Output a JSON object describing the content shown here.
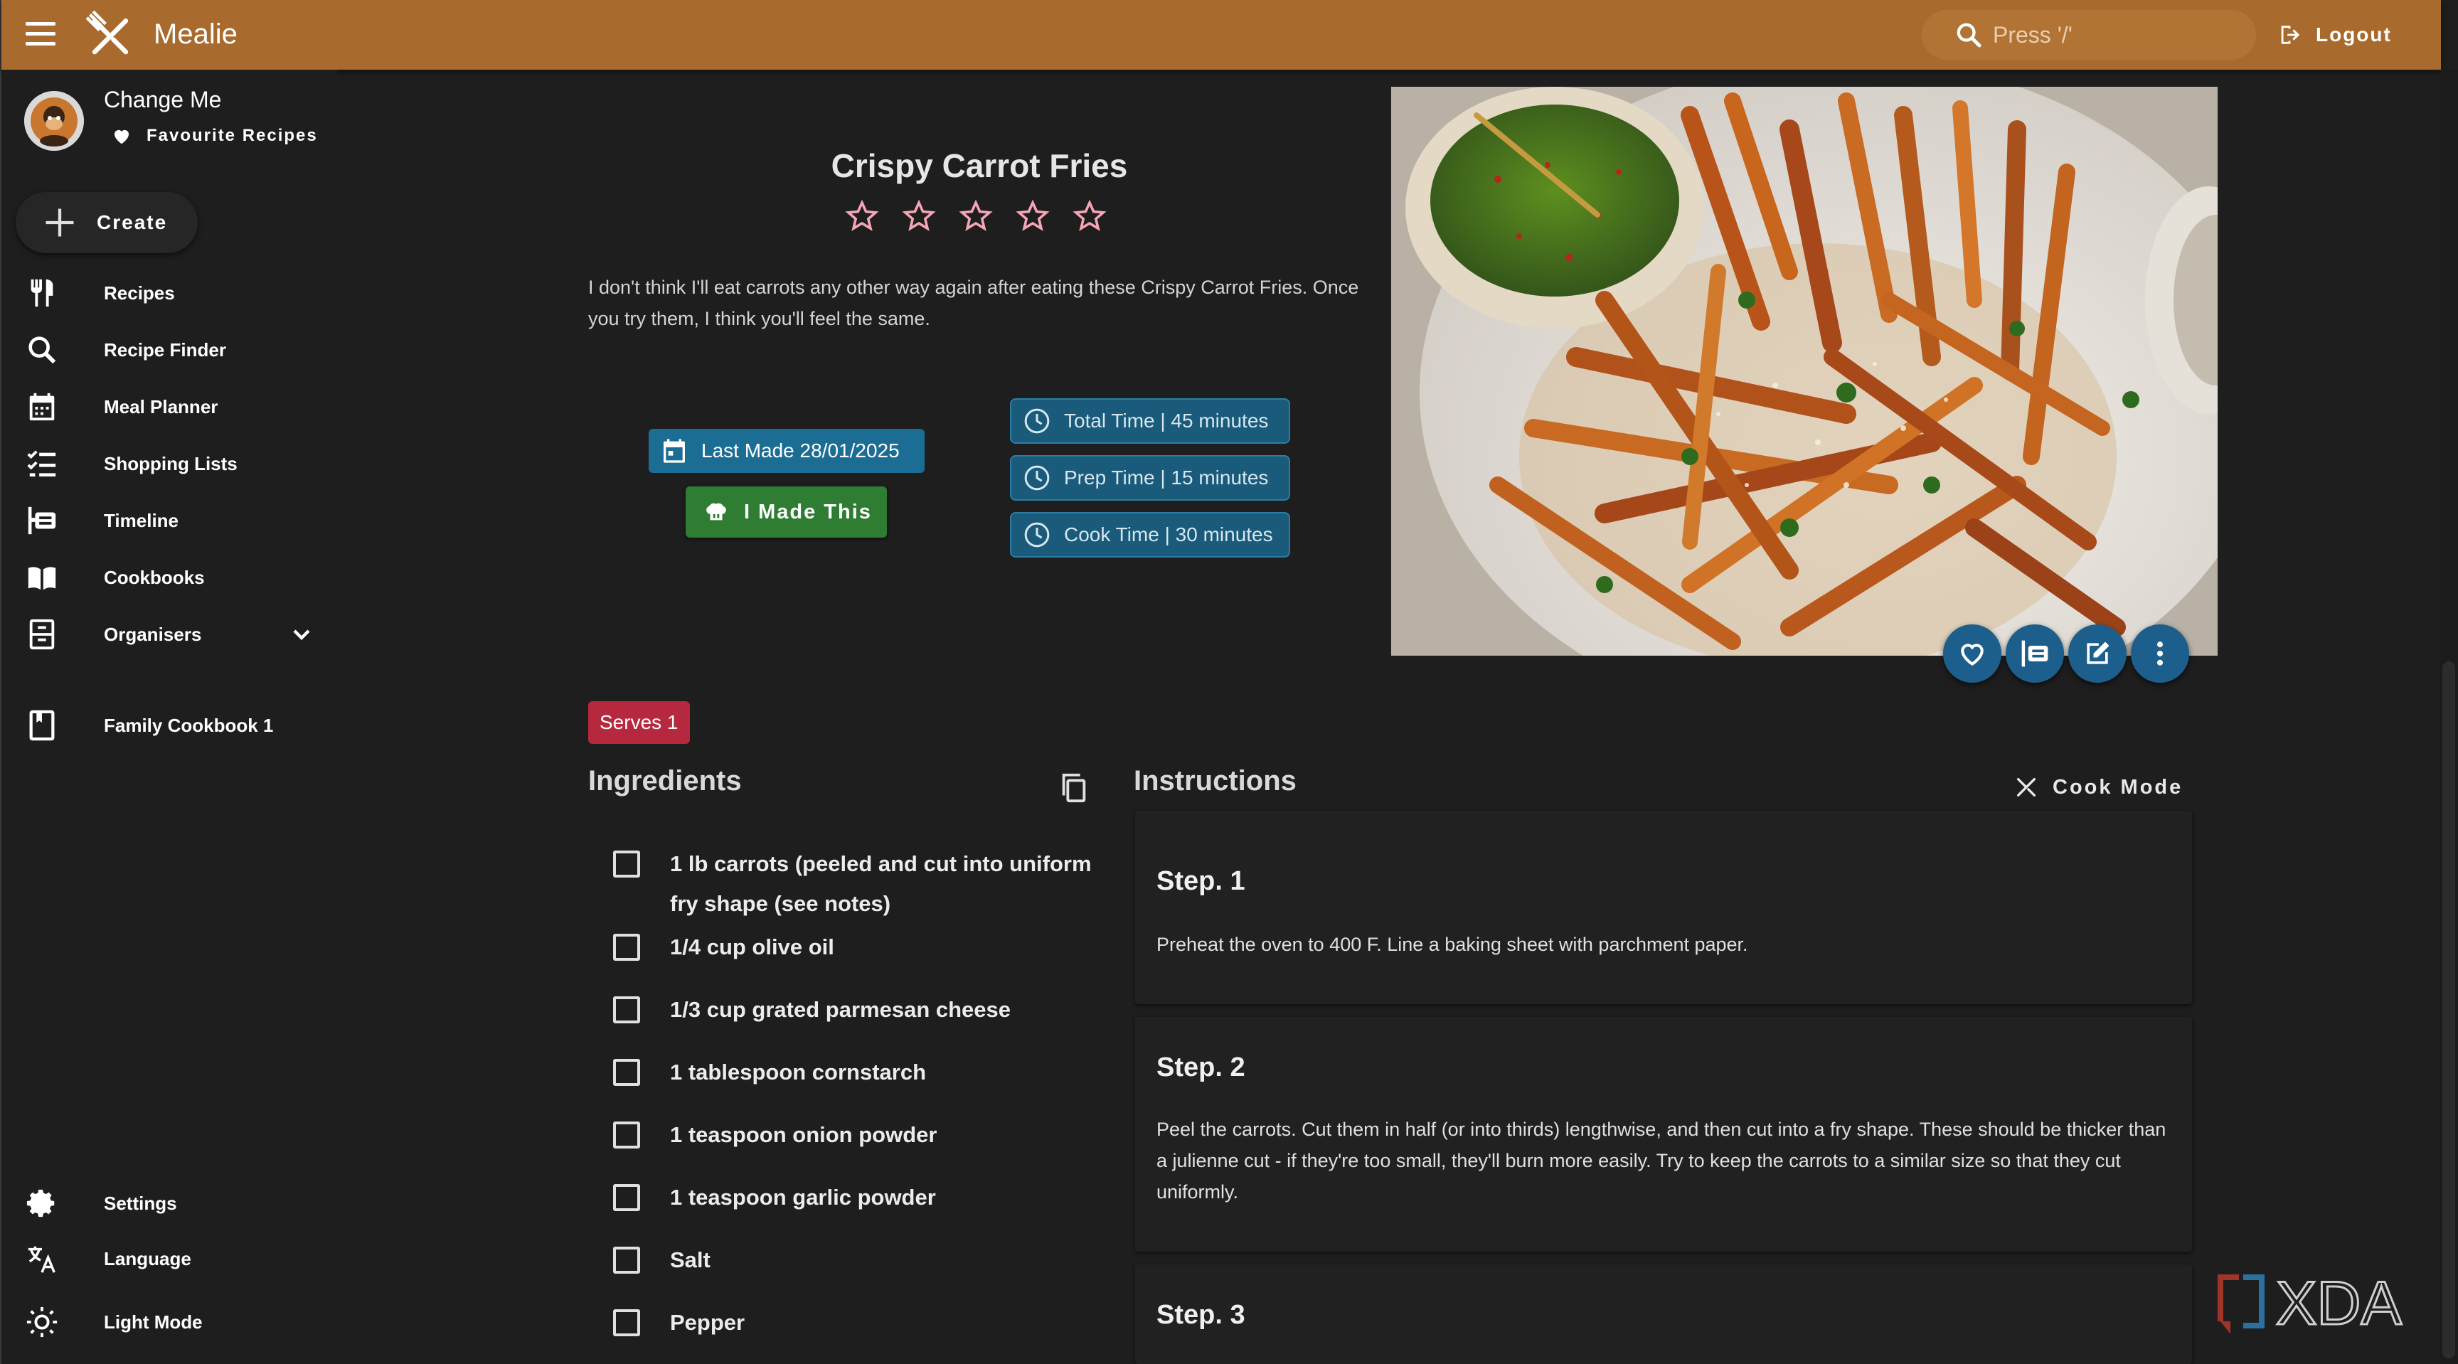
{
  "app": {
    "brand": "Mealie",
    "search_placeholder": "Press '/'",
    "logout_label": "Logout"
  },
  "user": {
    "name": "Change Me",
    "favourites_label": "Favourite Recipes"
  },
  "sidebar": {
    "create_label": "Create",
    "items": [
      {
        "label": "Recipes",
        "icon": "fork-knife-icon"
      },
      {
        "label": "Recipe Finder",
        "icon": "search-icon"
      },
      {
        "label": "Meal Planner",
        "icon": "calendar-icon"
      },
      {
        "label": "Shopping Lists",
        "icon": "checklist-icon"
      },
      {
        "label": "Timeline",
        "icon": "timeline-icon"
      },
      {
        "label": "Cookbooks",
        "icon": "open-book-icon"
      },
      {
        "label": "Organisers",
        "icon": "file-cabinet-icon"
      },
      {
        "label": "Family Cookbook 1",
        "icon": "book-icon"
      }
    ],
    "bottom": [
      {
        "label": "Settings",
        "icon": "gear-icon"
      },
      {
        "label": "Language",
        "icon": "translate-icon"
      },
      {
        "label": "Light Mode",
        "icon": "sun-icon"
      }
    ]
  },
  "recipe": {
    "title": "Crispy Carrot Fries",
    "rating": 0,
    "rating_max": 5,
    "description": "I don't think I'll eat carrots any other way again after eating these Crispy Carrot Fries. Once you try them, I think you'll feel the same.",
    "last_made": "Last Made 28/01/2025",
    "made_this_label": "I Made This",
    "times": {
      "total": "Total Time | 45 minutes",
      "prep": "Prep Time | 15 minutes",
      "cook": "Cook Time | 30 minutes"
    },
    "serves": "Serves 1"
  },
  "ingredients": {
    "title": "Ingredients",
    "items": [
      "1 lb carrots (peeled and cut into uniform fry shape (see notes)",
      "1/4 cup olive oil",
      "1/3 cup grated parmesan cheese",
      "1 tablespoon cornstarch",
      "1 teaspoon onion powder",
      "1 teaspoon garlic powder",
      "Salt",
      "Pepper"
    ]
  },
  "instructions": {
    "title": "Instructions",
    "cook_mode_label": "Cook Mode",
    "steps": [
      {
        "title": "Step. 1",
        "text": "Preheat the oven to 400 F. Line a baking sheet with parchment paper."
      },
      {
        "title": "Step. 2",
        "text": "Peel the carrots. Cut them in half (or into thirds) lengthwise, and then cut into a fry shape. These should be thicker than a julienne cut - if they're too small, they'll burn more easily. Try to keep the carrots to a similar size so that they cut uniformly."
      },
      {
        "title": "Step. 3",
        "text": ""
      }
    ]
  },
  "watermark": "XDA",
  "colors": {
    "appbar": "#a96a2d",
    "chip_blue": "#1b6d93",
    "made_green": "#2e7d32",
    "serves_red": "#b5283e",
    "star_pink": "#f4a6b4"
  }
}
